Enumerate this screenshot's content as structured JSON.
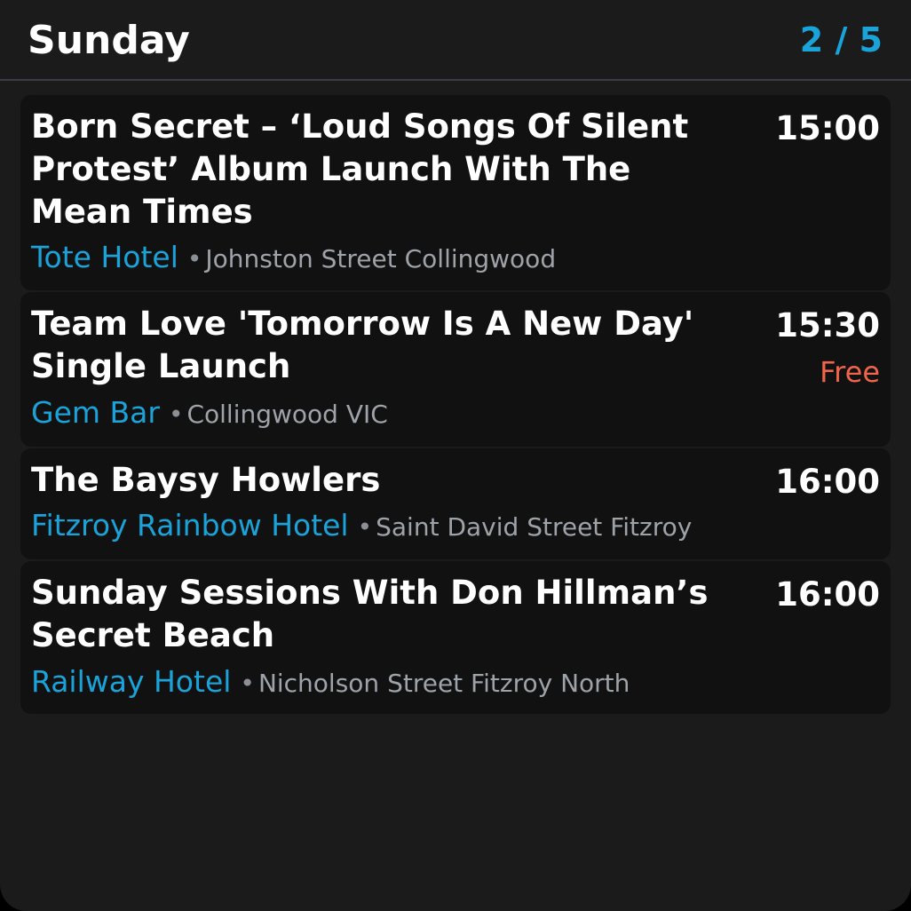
{
  "header": {
    "day": "Sunday",
    "pager": "2 / 5"
  },
  "events": [
    {
      "title": "Born Secret – ‘Loud Songs Of Silent Protest’ Album Launch With The Mean Times",
      "time": "15:00",
      "price": "",
      "venue": "Tote Hotel",
      "address": "Johnston Street Collingwood"
    },
    {
      "title": "Team Love 'Tomorrow Is A New Day' Single Launch",
      "time": "15:30",
      "price": "Free",
      "venue": "Gem Bar",
      "address": "Collingwood VIC"
    },
    {
      "title": "The Baysy Howlers",
      "time": "16:00",
      "price": "",
      "venue": "Fitzroy Rainbow Hotel",
      "address": "Saint David Street Fitzroy"
    },
    {
      "title": "Sunday Sessions With Don Hillman’s Secret Beach",
      "time": "16:00",
      "price": "",
      "venue": "Railway Hotel",
      "address": "Nicholson Street Fitzroy North"
    }
  ],
  "separator": "•",
  "colors": {
    "background": "#1b1b1b",
    "card": "#111111",
    "accent": "#1aa3d9",
    "price": "#f06549",
    "text": "#ffffff",
    "muted": "#9ea3aa"
  }
}
